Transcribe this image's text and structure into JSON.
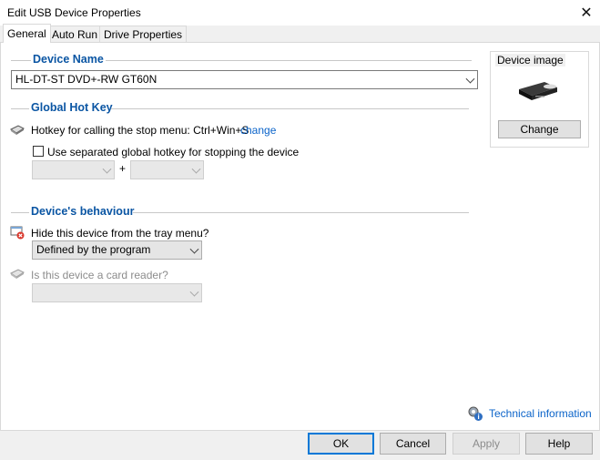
{
  "window": {
    "title": "Edit USB Device Properties"
  },
  "tabs": [
    {
      "label": "General",
      "active": true
    },
    {
      "label": "Auto Run",
      "active": false
    },
    {
      "label": "Drive Properties",
      "active": false
    }
  ],
  "device_name": {
    "section_title": "Device Name",
    "value": "HL-DT-ST DVD+-RW GT60N"
  },
  "device_image": {
    "title": "Device image",
    "change_label": "Change",
    "icon": "optical-drive-icon"
  },
  "hotkey": {
    "section_title": "Global Hot Key",
    "text": "Hotkey for calling the stop menu: Ctrl+Win+S",
    "change_link": "change",
    "checkbox_label": "Use separated global hotkey for stopping the device",
    "checkbox_checked": false,
    "plus": "+",
    "combo1_value": "",
    "combo2_value": ""
  },
  "behaviour": {
    "section_title": "Device's behaviour",
    "tray_label": "Hide this device from the tray menu?",
    "tray_value": "Defined by the program",
    "card_reader_label": "Is this device a card reader?",
    "card_reader_value": ""
  },
  "technical_info": "Technical information",
  "buttons": {
    "ok": "OK",
    "cancel": "Cancel",
    "apply": "Apply",
    "help": "Help"
  },
  "colors": {
    "section_title": "#0a55a3",
    "link": "#0a63c9",
    "default_button_border": "#0078d7"
  }
}
